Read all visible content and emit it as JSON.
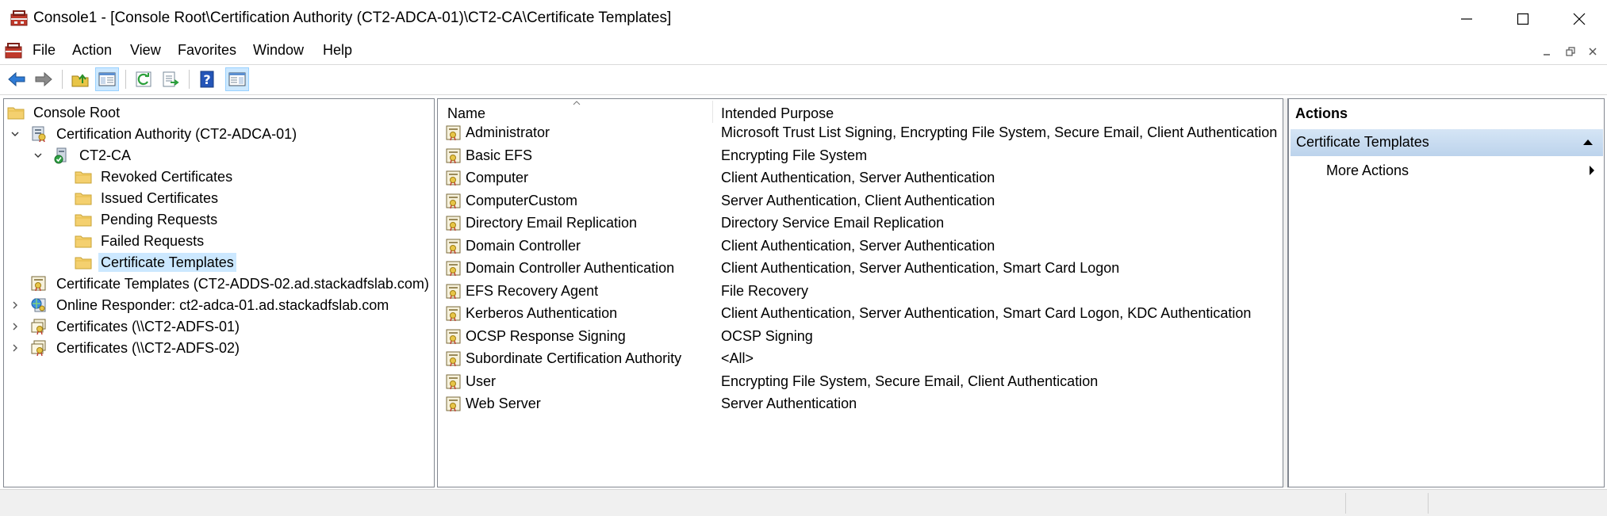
{
  "window": {
    "title": "Console1 - [Console Root\\Certification Authority (CT2-ADCA-01)\\CT2-CA\\Certificate Templates]",
    "icon": "mmc-toolbox-icon"
  },
  "menu": {
    "items": [
      "File",
      "Action",
      "View",
      "Favorites",
      "Window",
      "Help"
    ]
  },
  "toolbar": {
    "buttons": [
      "back-icon",
      "forward-icon",
      "up-folder-icon",
      "show-hide-console-tree-icon",
      "refresh-icon",
      "export-list-icon",
      "help-icon",
      "show-hide-action-pane-icon"
    ]
  },
  "tree": {
    "nodes": [
      {
        "label": "Console Root",
        "icon": "folder-icon"
      },
      {
        "label": "Certification Authority (CT2-ADCA-01)",
        "icon": "certification-authority-icon"
      },
      {
        "label": "CT2-CA",
        "icon": "ca-server-icon"
      },
      {
        "label": "Revoked Certificates",
        "icon": "folder-icon"
      },
      {
        "label": "Issued Certificates",
        "icon": "folder-icon"
      },
      {
        "label": "Pending Requests",
        "icon": "folder-icon"
      },
      {
        "label": "Failed Requests",
        "icon": "folder-icon"
      },
      {
        "label": "Certificate Templates",
        "icon": "folder-icon"
      },
      {
        "label": "Certificate Templates (CT2-ADDS-02.ad.stackadfslab.com)",
        "icon": "certificate-templates-icon"
      },
      {
        "label": "Online Responder: ct2-adca-01.ad.stackadfslab.com",
        "icon": "online-responder-icon"
      },
      {
        "label": "Certificates (\\\\CT2-ADFS-01)",
        "icon": "certificates-icon"
      },
      {
        "label": "Certificates (\\\\CT2-ADFS-02)",
        "icon": "certificates-icon"
      }
    ],
    "selected": "Certificate Templates"
  },
  "list": {
    "columns": [
      "Name",
      "Intended Purpose"
    ],
    "rows": [
      {
        "name": "Administrator",
        "purpose": "Microsoft Trust List Signing, Encrypting File System, Secure Email, Client Authentication"
      },
      {
        "name": "Basic EFS",
        "purpose": "Encrypting File System"
      },
      {
        "name": "Computer",
        "purpose": "Client Authentication, Server Authentication"
      },
      {
        "name": "ComputerCustom",
        "purpose": "Server Authentication, Client Authentication"
      },
      {
        "name": "Directory Email Replication",
        "purpose": "Directory Service Email Replication"
      },
      {
        "name": "Domain Controller",
        "purpose": "Client Authentication, Server Authentication"
      },
      {
        "name": "Domain Controller Authentication",
        "purpose": "Client Authentication, Server Authentication, Smart Card Logon"
      },
      {
        "name": "EFS Recovery Agent",
        "purpose": "File Recovery"
      },
      {
        "name": "Kerberos Authentication",
        "purpose": "Client Authentication, Server Authentication, Smart Card Logon, KDC Authentication"
      },
      {
        "name": "OCSP Response Signing",
        "purpose": "OCSP Signing"
      },
      {
        "name": "Subordinate Certification Authority",
        "purpose": "<All>"
      },
      {
        "name": "User",
        "purpose": "Encrypting File System, Secure Email, Client Authentication"
      },
      {
        "name": "Web Server",
        "purpose": "Server Authentication"
      }
    ]
  },
  "actions": {
    "title": "Actions",
    "section": "Certificate Templates",
    "items": [
      "More Actions"
    ]
  },
  "colors": {
    "selection": "#cce8ff",
    "actions_header": "#c3d9f0",
    "border": "#828790"
  }
}
